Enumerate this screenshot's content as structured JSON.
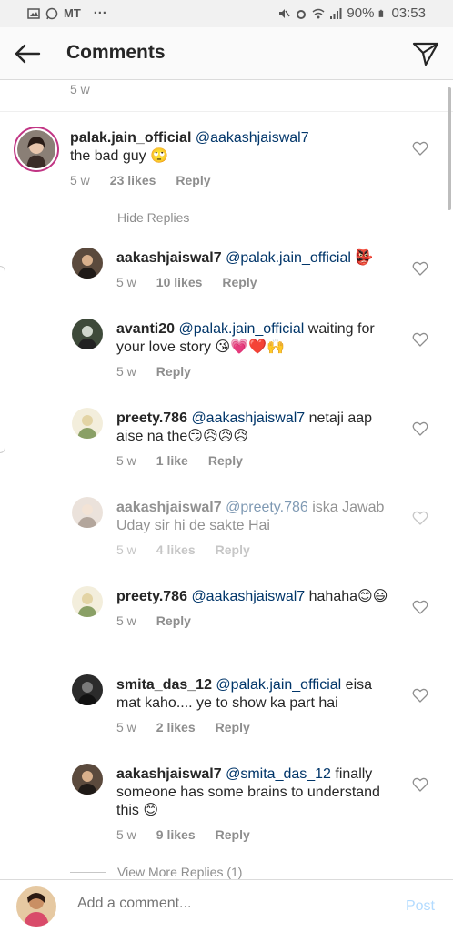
{
  "status_bar": {
    "carrier": "MT",
    "more": "···",
    "battery": "90%",
    "time": "03:53"
  },
  "header": {
    "title": "Comments",
    "back_icon": "back-arrow-icon",
    "share_icon": "direct-share-icon"
  },
  "top_previous": {
    "time": "5 w"
  },
  "main_comment": {
    "username": "palak.jain_official",
    "mention": "@aakashjaiswal7",
    "text": "the bad guy 🙄",
    "time": "5 w",
    "likes": "23 likes",
    "reply": "Reply"
  },
  "hide_replies": "Hide Replies",
  "replies": [
    {
      "username": "aakashjaiswal7",
      "mention": "@palak.jain_official",
      "text": " 👺",
      "time": "5 w",
      "likes": "10 likes",
      "reply": "Reply",
      "faded": false
    },
    {
      "username": "avanti20",
      "mention": "@palak.jain_official",
      "text": " waiting for your love story 😘💗❤️🙌",
      "time": "5 w",
      "likes": "",
      "reply": "Reply",
      "faded": false
    },
    {
      "username": "preety.786",
      "mention": "@aakashjaiswal7",
      "text": " netaji aap aise na the😏😥😥😥",
      "time": "5 w",
      "likes": "1 like",
      "reply": "Reply",
      "faded": false
    },
    {
      "username": "aakashjaiswal7",
      "mention": "@preety.786",
      "text": " iska Jawab Uday sir hi de sakte Hai",
      "time": "5 w",
      "likes": "4 likes",
      "reply": "Reply",
      "faded": true
    },
    {
      "username": "preety.786",
      "mention": "@aakashjaiswal7",
      "text": " hahaha😊😃",
      "time": "5 w",
      "likes": "",
      "reply": "Reply",
      "faded": false
    },
    {
      "username": "smita_das_12",
      "mention": "@palak.jain_official",
      "text": " eisa mat kaho.... ye to show ka part hai",
      "time": "5 w",
      "likes": "2 likes",
      "reply": "Reply",
      "faded": false
    },
    {
      "username": "aakashjaiswal7",
      "mention": "@smita_das_12",
      "text": " finally someone has some brains to understand this 😊",
      "time": "5 w",
      "likes": "9 likes",
      "reply": "Reply",
      "faded": false
    }
  ],
  "view_more": "View More Replies (1)",
  "composer": {
    "placeholder": "Add a comment...",
    "post_label": "Post"
  },
  "colors": {
    "mention": "#003569",
    "meta": "#8e8e8e",
    "post_disabled": "#b3dbff"
  }
}
